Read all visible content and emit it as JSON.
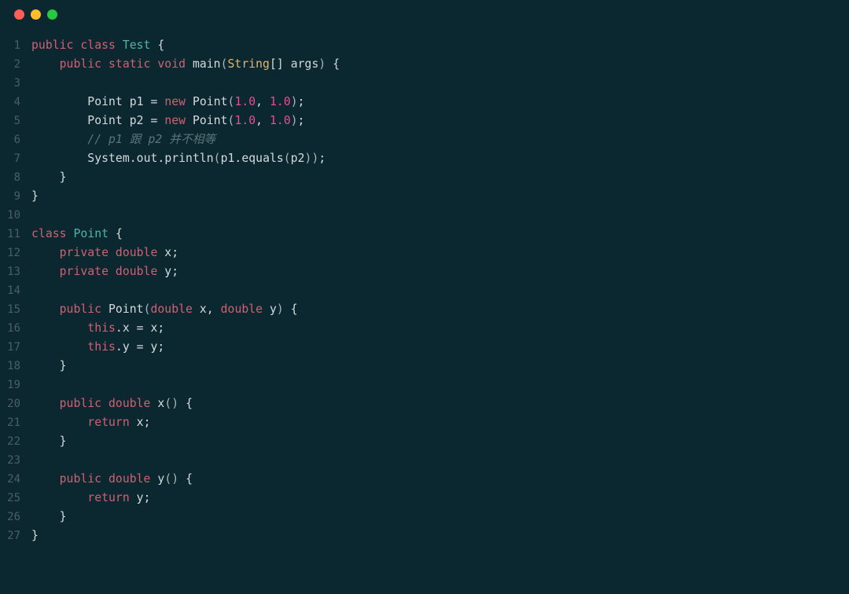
{
  "window": {
    "buttons": {
      "close": "close-button",
      "minimize": "minimize-button",
      "maximize": "maximize-button"
    }
  },
  "code": {
    "language": "java",
    "lines": [
      {
        "n": 1,
        "tokens": [
          [
            "kw",
            "public"
          ],
          [
            "sp",
            " "
          ],
          [
            "kw",
            "class"
          ],
          [
            "sp",
            " "
          ],
          [
            "type",
            "Test"
          ],
          [
            "sp",
            " "
          ],
          [
            "punct",
            "{"
          ]
        ]
      },
      {
        "n": 2,
        "tokens": [
          [
            "sp",
            "    "
          ],
          [
            "kw",
            "public"
          ],
          [
            "sp",
            " "
          ],
          [
            "kw",
            "static"
          ],
          [
            "sp",
            " "
          ],
          [
            "kw",
            "void"
          ],
          [
            "sp",
            " "
          ],
          [
            "method",
            "main"
          ],
          [
            "paren",
            "("
          ],
          [
            "builtin",
            "String"
          ],
          [
            "punct",
            "[]"
          ],
          [
            "sp",
            " "
          ],
          [
            "ident",
            "args"
          ],
          [
            "paren",
            ")"
          ],
          [
            "sp",
            " "
          ],
          [
            "punct",
            "{"
          ]
        ]
      },
      {
        "n": 3,
        "tokens": []
      },
      {
        "n": 4,
        "tokens": [
          [
            "sp",
            "        "
          ],
          [
            "ident",
            "Point p1 "
          ],
          [
            "punct",
            "="
          ],
          [
            "sp",
            " "
          ],
          [
            "kw",
            "new"
          ],
          [
            "sp",
            " "
          ],
          [
            "ident",
            "Point"
          ],
          [
            "paren",
            "("
          ],
          [
            "num",
            "1.0"
          ],
          [
            "punct",
            ","
          ],
          [
            "sp",
            " "
          ],
          [
            "num",
            "1.0"
          ],
          [
            "paren",
            ")"
          ],
          [
            "punct",
            ";"
          ]
        ]
      },
      {
        "n": 5,
        "tokens": [
          [
            "sp",
            "        "
          ],
          [
            "ident",
            "Point p2 "
          ],
          [
            "punct",
            "="
          ],
          [
            "sp",
            " "
          ],
          [
            "kw",
            "new"
          ],
          [
            "sp",
            " "
          ],
          [
            "ident",
            "Point"
          ],
          [
            "paren",
            "("
          ],
          [
            "num",
            "1.0"
          ],
          [
            "punct",
            ","
          ],
          [
            "sp",
            " "
          ],
          [
            "num",
            "1.0"
          ],
          [
            "paren",
            ")"
          ],
          [
            "punct",
            ";"
          ]
        ]
      },
      {
        "n": 6,
        "tokens": [
          [
            "sp",
            "        "
          ],
          [
            "comment",
            "// p1 跟 p2 并不相等"
          ]
        ]
      },
      {
        "n": 7,
        "tokens": [
          [
            "sp",
            "        "
          ],
          [
            "ident",
            "System"
          ],
          [
            "punct",
            "."
          ],
          [
            "ident",
            "out"
          ],
          [
            "punct",
            "."
          ],
          [
            "ident",
            "println"
          ],
          [
            "paren",
            "("
          ],
          [
            "ident",
            "p1"
          ],
          [
            "punct",
            "."
          ],
          [
            "ident",
            "equals"
          ],
          [
            "paren",
            "("
          ],
          [
            "ident",
            "p2"
          ],
          [
            "paren",
            "))"
          ],
          [
            "punct",
            ";"
          ]
        ]
      },
      {
        "n": 8,
        "tokens": [
          [
            "sp",
            "    "
          ],
          [
            "punct",
            "}"
          ]
        ]
      },
      {
        "n": 9,
        "tokens": [
          [
            "punct",
            "}"
          ]
        ]
      },
      {
        "n": 10,
        "tokens": []
      },
      {
        "n": 11,
        "tokens": [
          [
            "kw",
            "class"
          ],
          [
            "sp",
            " "
          ],
          [
            "type",
            "Point"
          ],
          [
            "sp",
            " "
          ],
          [
            "punct",
            "{"
          ]
        ]
      },
      {
        "n": 12,
        "tokens": [
          [
            "sp",
            "    "
          ],
          [
            "kw",
            "private"
          ],
          [
            "sp",
            " "
          ],
          [
            "kw",
            "double"
          ],
          [
            "sp",
            " "
          ],
          [
            "ident",
            "x"
          ],
          [
            "punct",
            ";"
          ]
        ]
      },
      {
        "n": 13,
        "tokens": [
          [
            "sp",
            "    "
          ],
          [
            "kw",
            "private"
          ],
          [
            "sp",
            " "
          ],
          [
            "kw",
            "double"
          ],
          [
            "sp",
            " "
          ],
          [
            "ident",
            "y"
          ],
          [
            "punct",
            ";"
          ]
        ]
      },
      {
        "n": 14,
        "tokens": []
      },
      {
        "n": 15,
        "tokens": [
          [
            "sp",
            "    "
          ],
          [
            "kw",
            "public"
          ],
          [
            "sp",
            " "
          ],
          [
            "ident",
            "Point"
          ],
          [
            "paren",
            "("
          ],
          [
            "kw",
            "double"
          ],
          [
            "sp",
            " "
          ],
          [
            "ident",
            "x"
          ],
          [
            "punct",
            ","
          ],
          [
            "sp",
            " "
          ],
          [
            "kw",
            "double"
          ],
          [
            "sp",
            " "
          ],
          [
            "ident",
            "y"
          ],
          [
            "paren",
            ")"
          ],
          [
            "sp",
            " "
          ],
          [
            "punct",
            "{"
          ]
        ]
      },
      {
        "n": 16,
        "tokens": [
          [
            "sp",
            "        "
          ],
          [
            "kw",
            "this"
          ],
          [
            "punct",
            "."
          ],
          [
            "ident",
            "x "
          ],
          [
            "punct",
            "="
          ],
          [
            "ident",
            " x"
          ],
          [
            "punct",
            ";"
          ]
        ]
      },
      {
        "n": 17,
        "tokens": [
          [
            "sp",
            "        "
          ],
          [
            "kw",
            "this"
          ],
          [
            "punct",
            "."
          ],
          [
            "ident",
            "y "
          ],
          [
            "punct",
            "="
          ],
          [
            "ident",
            " y"
          ],
          [
            "punct",
            ";"
          ]
        ]
      },
      {
        "n": 18,
        "tokens": [
          [
            "sp",
            "    "
          ],
          [
            "punct",
            "}"
          ]
        ]
      },
      {
        "n": 19,
        "tokens": []
      },
      {
        "n": 20,
        "tokens": [
          [
            "sp",
            "    "
          ],
          [
            "kw",
            "public"
          ],
          [
            "sp",
            " "
          ],
          [
            "kw",
            "double"
          ],
          [
            "sp",
            " "
          ],
          [
            "method",
            "x"
          ],
          [
            "paren",
            "()"
          ],
          [
            "sp",
            " "
          ],
          [
            "punct",
            "{"
          ]
        ]
      },
      {
        "n": 21,
        "tokens": [
          [
            "sp",
            "        "
          ],
          [
            "kw",
            "return"
          ],
          [
            "sp",
            " "
          ],
          [
            "ident",
            "x"
          ],
          [
            "punct",
            ";"
          ]
        ]
      },
      {
        "n": 22,
        "tokens": [
          [
            "sp",
            "    "
          ],
          [
            "punct",
            "}"
          ]
        ]
      },
      {
        "n": 23,
        "tokens": []
      },
      {
        "n": 24,
        "tokens": [
          [
            "sp",
            "    "
          ],
          [
            "kw",
            "public"
          ],
          [
            "sp",
            " "
          ],
          [
            "kw",
            "double"
          ],
          [
            "sp",
            " "
          ],
          [
            "method",
            "y"
          ],
          [
            "paren",
            "()"
          ],
          [
            "sp",
            " "
          ],
          [
            "punct",
            "{"
          ]
        ]
      },
      {
        "n": 25,
        "tokens": [
          [
            "sp",
            "        "
          ],
          [
            "kw",
            "return"
          ],
          [
            "sp",
            " "
          ],
          [
            "ident",
            "y"
          ],
          [
            "punct",
            ";"
          ]
        ]
      },
      {
        "n": 26,
        "tokens": [
          [
            "sp",
            "    "
          ],
          [
            "punct",
            "}"
          ]
        ]
      },
      {
        "n": 27,
        "tokens": [
          [
            "punct",
            "}"
          ]
        ]
      }
    ]
  }
}
